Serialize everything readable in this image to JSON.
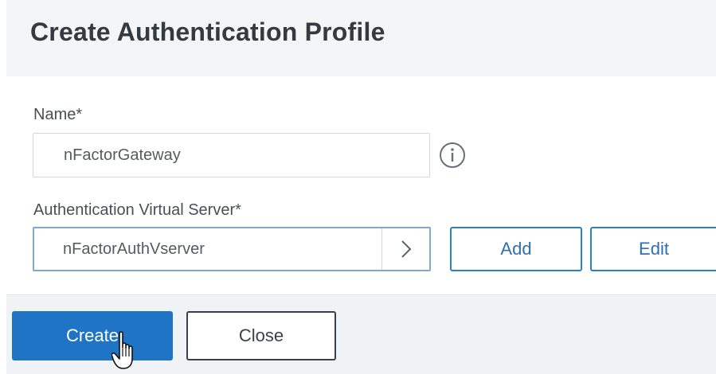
{
  "dialog": {
    "title": "Create Authentication Profile"
  },
  "form": {
    "name_label": "Name*",
    "name_value": "nFactorGateway",
    "vserver_label": "Authentication Virtual Server*",
    "vserver_value": "nFactorAuthVserver"
  },
  "buttons": {
    "add": "Add",
    "edit": "Edit",
    "create": "Create",
    "close": "Close"
  },
  "icons": {
    "info": "info-icon",
    "select_arrow": "chevron-right-icon",
    "cursor": "hand-pointer-icon"
  },
  "colors": {
    "primary": "#1f74c5",
    "outline_accent": "#2c80c8",
    "header_bg": "#f3f5f7"
  }
}
